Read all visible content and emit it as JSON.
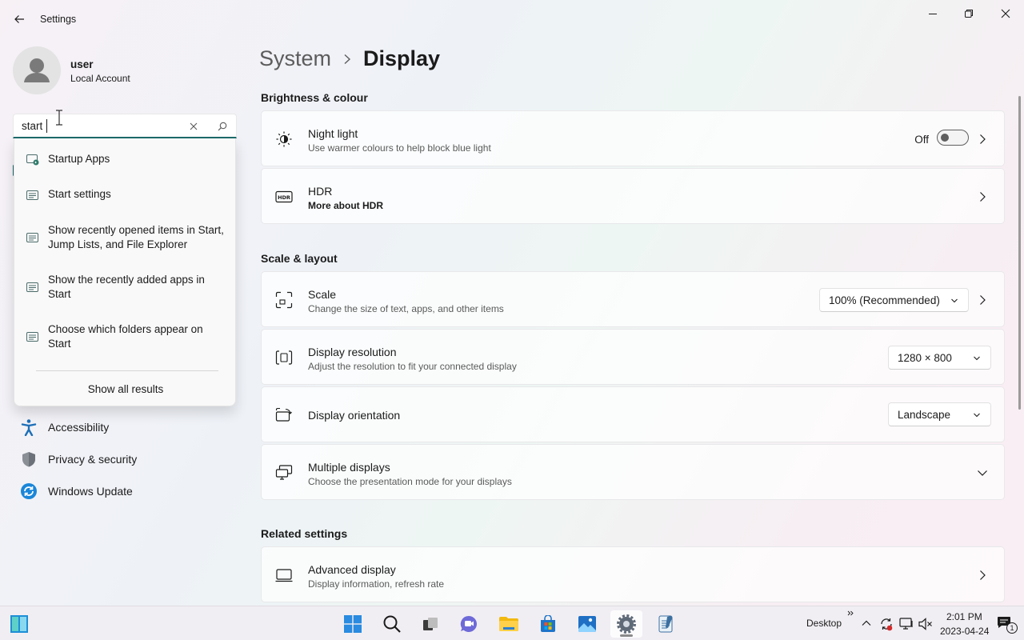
{
  "window": {
    "title": "Settings"
  },
  "profile": {
    "name": "user",
    "account_type": "Local Account"
  },
  "search": {
    "value": "start",
    "suggestions": [
      {
        "label": "Startup Apps",
        "icon": "startup-apps-icon"
      },
      {
        "label": "Start settings",
        "icon": "settings-page-icon"
      },
      {
        "label": "Show recently opened items in Start, Jump Lists, and File Explorer",
        "icon": "settings-page-icon"
      },
      {
        "label": "Show the recently added apps in Start",
        "icon": "settings-page-icon"
      },
      {
        "label": "Choose which folders appear on Start",
        "icon": "settings-page-icon"
      }
    ],
    "show_all": "Show all results"
  },
  "sidebar": {
    "items": [
      {
        "label": "Accessibility",
        "icon": "accessibility-icon"
      },
      {
        "label": "Privacy & security",
        "icon": "shield-icon"
      },
      {
        "label": "Windows Update",
        "icon": "windows-update-icon"
      }
    ]
  },
  "breadcrumb": {
    "parent": "System",
    "current": "Display"
  },
  "sections": {
    "brightness": "Brightness & colour",
    "scale_layout": "Scale & layout",
    "related": "Related settings"
  },
  "cards": {
    "night_light": {
      "title": "Night light",
      "subtitle": "Use warmer colours to help block blue light",
      "state": "Off",
      "enabled": false
    },
    "hdr": {
      "title": "HDR",
      "subtitle": "More about HDR"
    },
    "scale": {
      "title": "Scale",
      "subtitle": "Change the size of text, apps, and other items",
      "value": "100% (Recommended)"
    },
    "resolution": {
      "title": "Display resolution",
      "subtitle": "Adjust the resolution to fit your connected display",
      "value": "1280 × 800"
    },
    "orientation": {
      "title": "Display orientation",
      "value": "Landscape"
    },
    "multiple": {
      "title": "Multiple displays",
      "subtitle": "Choose the presentation mode for your displays"
    },
    "advanced": {
      "title": "Advanced display",
      "subtitle": "Display information, refresh rate"
    }
  },
  "taskbar": {
    "desktop_label": "Desktop",
    "time": "2:01 PM",
    "date": "2023-04-24",
    "notification_count": "1"
  },
  "colors": {
    "accent": "#1e6b6b",
    "toggle_off": "#5f5f5f"
  }
}
